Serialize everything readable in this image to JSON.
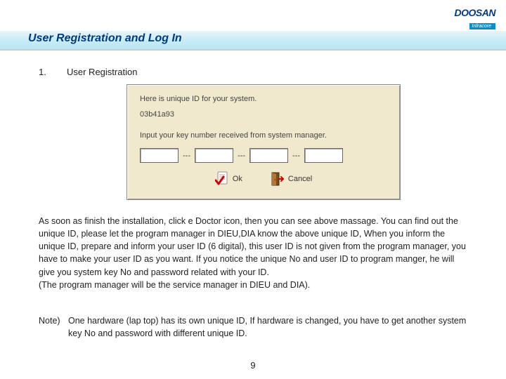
{
  "logo": {
    "main": "DOOSAN",
    "sub": "Infracore"
  },
  "title": "User Registration and Log In",
  "section": {
    "num": "1.",
    "title": "User Registration"
  },
  "dialog": {
    "line1": "Here is unique ID for your system.",
    "uid": "03b41a93",
    "prompt": "Input your key number received from system manager.",
    "sep": "---",
    "ok": "Ok",
    "cancel": "Cancel"
  },
  "body": "As soon as finish the installation, click e Doctor icon, then you can see above massage. You can find out the unique ID, please let the program manager in DIEU,DIA know the above unique ID, When you inform the unique ID, prepare and inform your user ID (6 digital), this user ID is not given from the program manager, you have to make your user ID as you want. If you notice the unique No and user ID to program manger, he will give you system key No and password related with your ID.\n(The program manager will be the service manager in DIEU and DIA).",
  "note": {
    "label": "Note)",
    "body": "One hardware (lap top) has its own unique ID, If hardware is changed, you have to get another system key No and password with different unique ID."
  },
  "page": "9"
}
